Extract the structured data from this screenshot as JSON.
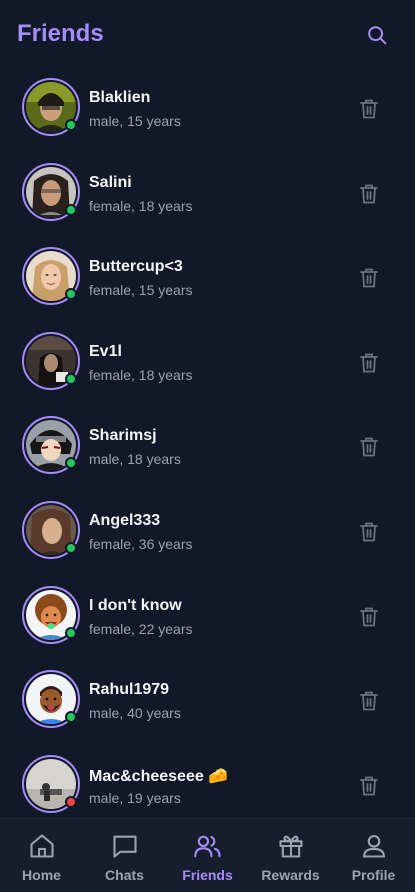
{
  "header": {
    "title": "Friends"
  },
  "colors": {
    "accent": "#a78bfa",
    "online": "#22c55e",
    "offline": "#ef4444"
  },
  "friends": [
    {
      "name": "Blaklien",
      "meta": "male, 15 years",
      "status": "online"
    },
    {
      "name": "Salini",
      "meta": "female, 18 years",
      "status": "online"
    },
    {
      "name": "Buttercup<3",
      "meta": "female, 15 years",
      "status": "online"
    },
    {
      "name": "Ev1l",
      "meta": "female, 18 years",
      "status": "online"
    },
    {
      "name": "Sharimsj",
      "meta": "male, 18 years",
      "status": "online"
    },
    {
      "name": "Angel333",
      "meta": "female, 36 years",
      "status": "online"
    },
    {
      "name": "I don't know",
      "meta": "female, 22 years",
      "status": "online"
    },
    {
      "name": "Rahul1979",
      "meta": "male, 40 years",
      "status": "online"
    },
    {
      "name": "Mac&cheeseee 🧀",
      "meta": "male, 19 years",
      "status": "offline"
    }
  ],
  "nav": {
    "items": [
      {
        "label": "Home",
        "icon": "home-icon"
      },
      {
        "label": "Chats",
        "icon": "chat-icon"
      },
      {
        "label": "Friends",
        "icon": "friends-icon",
        "active": true
      },
      {
        "label": "Rewards",
        "icon": "gift-icon"
      },
      {
        "label": "Profile",
        "icon": "profile-icon"
      }
    ]
  }
}
